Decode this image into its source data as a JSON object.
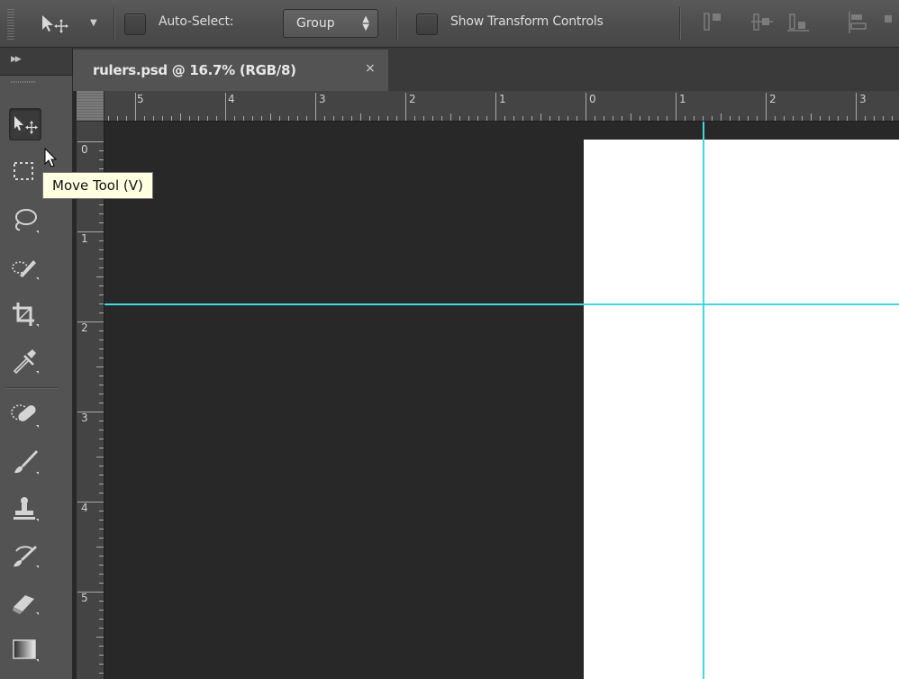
{
  "options_bar": {
    "tool_preset_icon": "move-tool-icon",
    "auto_select_label": "Auto-Select:",
    "auto_select_checked": false,
    "auto_select_target": "Group",
    "show_transform_label": "Show Transform Controls",
    "show_transform_checked": false,
    "align_icons": [
      "align-top-edges-icon",
      "align-vertical-centers-icon",
      "align-bottom-edges-icon",
      "align-left-edges-icon"
    ]
  },
  "document_tab": {
    "label": "rulers.psd @ 16.7% (RGB/8)",
    "close_label": "×"
  },
  "rulers": {
    "top_labels": [
      "5",
      "4",
      "3",
      "2",
      "1",
      "0",
      "1",
      "2",
      "3"
    ],
    "left_labels": [
      "0",
      "1",
      "2",
      "3",
      "4",
      "5"
    ]
  },
  "toolbox": {
    "tools": [
      {
        "name": "move-tool",
        "icon": "move-icon",
        "active": true
      },
      {
        "name": "marquee-tool",
        "icon": "rectangular-marquee-icon",
        "active": false
      },
      {
        "name": "lasso-tool",
        "icon": "lasso-icon",
        "active": false
      },
      {
        "name": "quick-selection-tool",
        "icon": "quick-selection-icon",
        "active": false
      },
      {
        "name": "crop-tool",
        "icon": "crop-icon",
        "active": false
      },
      {
        "name": "eyedropper-tool",
        "icon": "eyedropper-icon",
        "active": false
      },
      {
        "name": "healing-brush-tool",
        "icon": "spot-healing-brush-icon",
        "active": false
      },
      {
        "name": "brush-tool",
        "icon": "brush-icon",
        "active": false
      },
      {
        "name": "clone-stamp-tool",
        "icon": "clone-stamp-icon",
        "active": false
      },
      {
        "name": "history-brush-tool",
        "icon": "history-brush-icon",
        "active": false
      },
      {
        "name": "eraser-tool",
        "icon": "eraser-icon",
        "active": false
      },
      {
        "name": "gradient-tool",
        "icon": "gradient-icon",
        "active": false
      }
    ]
  },
  "tooltip": {
    "text": "Move Tool (V)"
  },
  "colors": {
    "guide": "#3fd8e0",
    "pasteboard": "#282828",
    "artboard": "#ffffff",
    "tooltip_bg": "#ffffe1"
  }
}
